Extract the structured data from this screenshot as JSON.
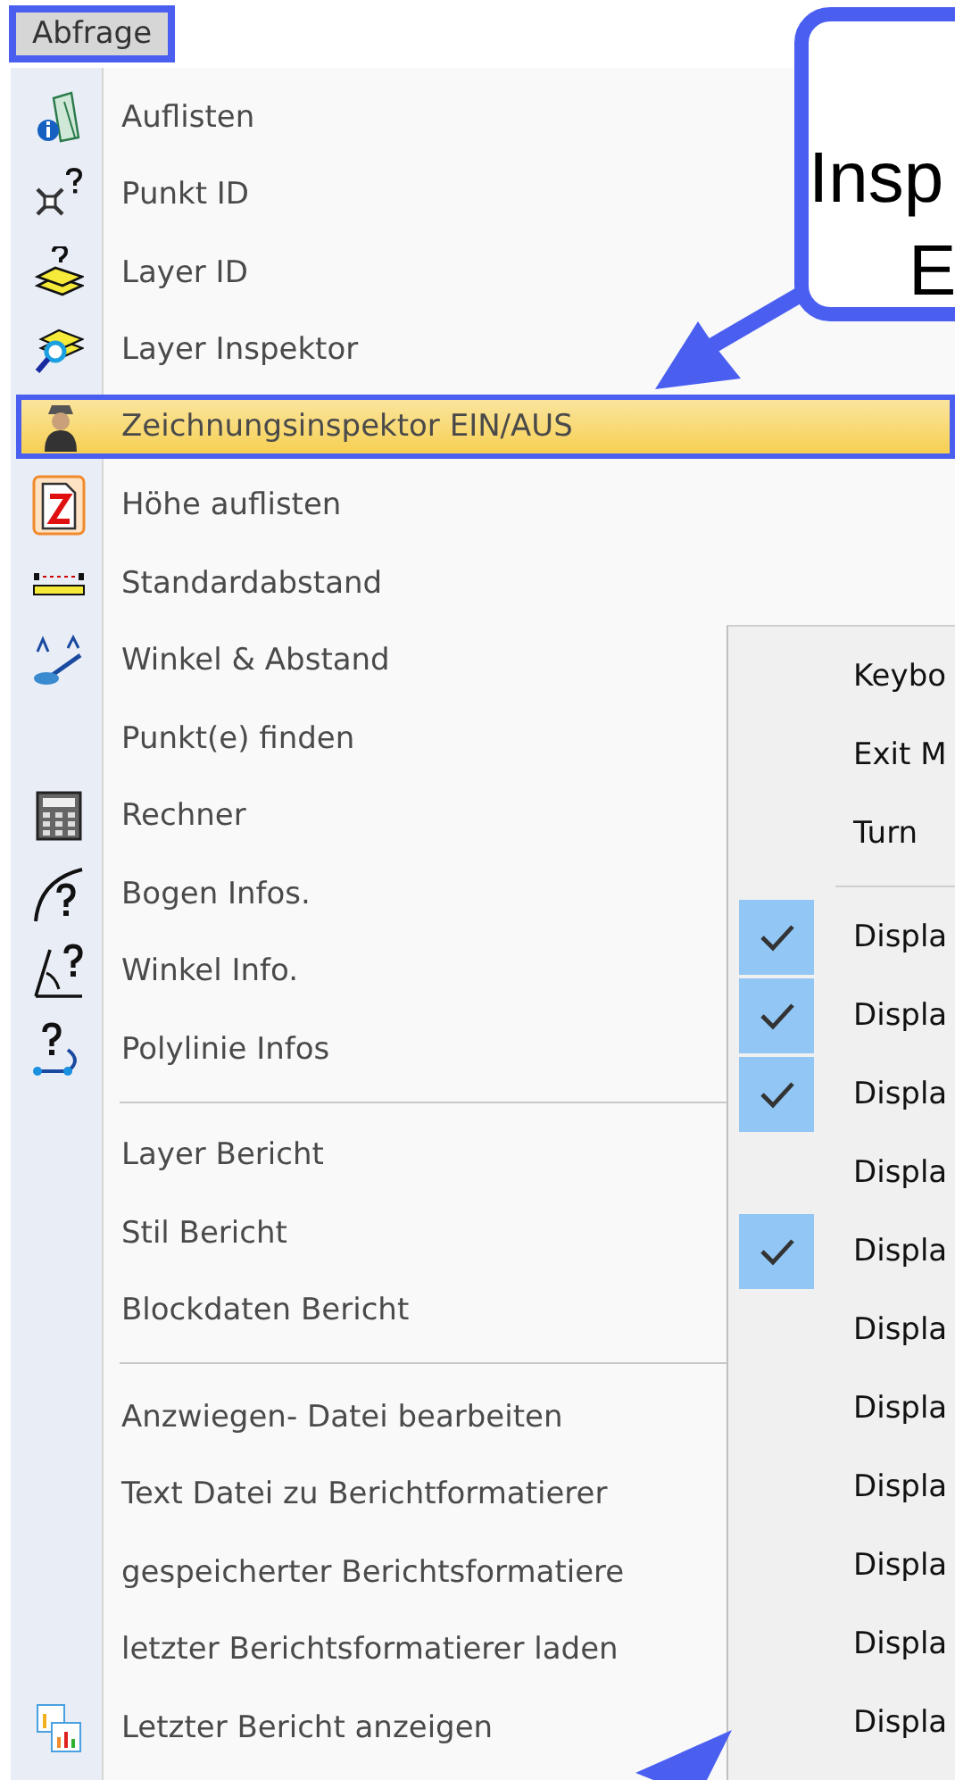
{
  "menu_bar": {
    "label": "Abfrage",
    "selected": true
  },
  "main_menu": {
    "groups": [
      [
        {
          "label": "Auflisten",
          "selected": false
        },
        {
          "label": "Punkt ID",
          "selected": false
        },
        {
          "label": "Layer ID",
          "selected": false
        },
        {
          "label": "Layer Inspektor",
          "selected": false
        },
        {
          "label": "Zeichnungsinspektor EIN/AUS",
          "selected": true
        },
        {
          "label": "Höhe auflisten",
          "selected": false
        },
        {
          "label": "Standardabstand",
          "selected": false
        },
        {
          "label": "Winkel & Abstand",
          "selected": false
        },
        {
          "label": "Punkt(e) finden",
          "selected": false
        },
        {
          "label": "Rechner",
          "selected": false
        },
        {
          "label": "Bogen Infos.",
          "selected": false
        },
        {
          "label": "Winkel Info.",
          "selected": false
        },
        {
          "label": "Polylinie Infos",
          "selected": false
        }
      ],
      [
        {
          "label": "Layer Bericht",
          "selected": false
        },
        {
          "label": "Stil Bericht",
          "selected": false
        },
        {
          "label": "Blockdaten Bericht",
          "selected": false
        }
      ],
      [
        {
          "label": "Anzwiegen- Datei bearbeiten",
          "selected": false
        },
        {
          "label": "Text Datei zu Berichtformatierer",
          "selected": false
        },
        {
          "label": "gespeicherter Berichtsformatiere",
          "selected": false
        },
        {
          "label": "letzter Berichtsformatierer laden",
          "selected": false
        },
        {
          "label": "Letzter Bericht anzeigen",
          "selected": false
        }
      ]
    ]
  },
  "submenu": {
    "groups": [
      [
        {
          "label": "Keybo",
          "checked": false
        },
        {
          "label": "Exit M",
          "checked": false
        },
        {
          "label": "Turn",
          "checked": false
        }
      ],
      [
        {
          "label": "Displa",
          "checked": true
        },
        {
          "label": "Displa",
          "checked": true
        },
        {
          "label": "Displa",
          "checked": true
        },
        {
          "label": "Displa",
          "checked": false
        },
        {
          "label": "Displa",
          "checked": true
        },
        {
          "label": "Displa",
          "checked": false
        },
        {
          "label": "Displa",
          "checked": false
        },
        {
          "label": "Displa",
          "checked": false
        },
        {
          "label": "Displa",
          "checked": false
        },
        {
          "label": "Displa",
          "checked": false
        },
        {
          "label": "Displa",
          "checked": false
        }
      ]
    ]
  },
  "callout": {
    "lines": [
      "Insp",
      "E"
    ]
  }
}
